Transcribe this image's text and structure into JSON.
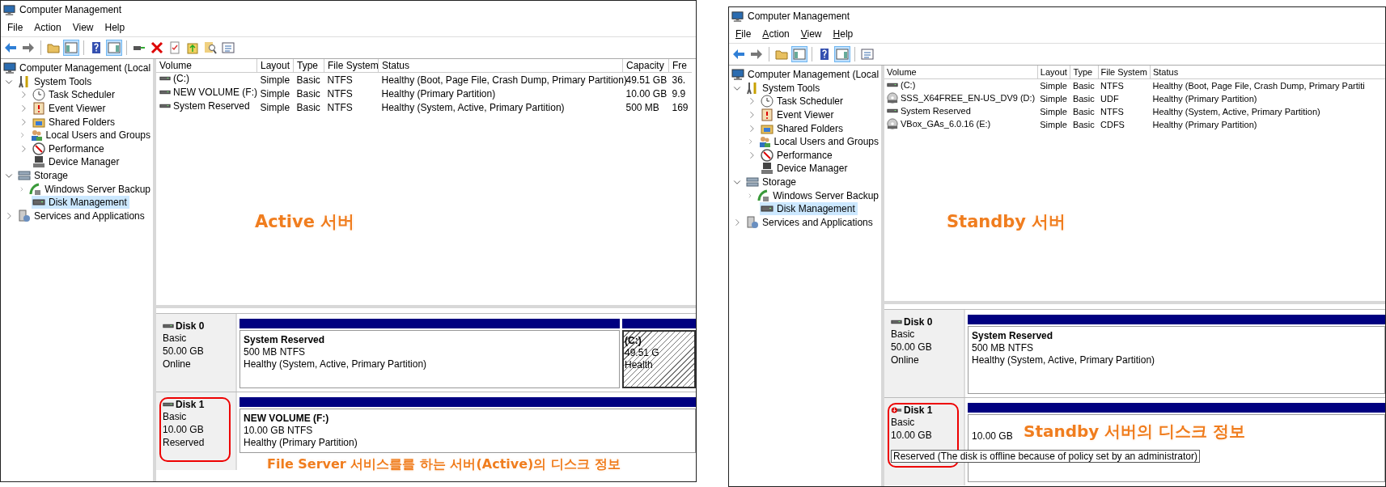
{
  "windows": [
    {
      "title": "Computer Management",
      "access_keys_underlined": false,
      "menu": [
        {
          "label": "File"
        },
        {
          "label": "Action"
        },
        {
          "label": "View"
        },
        {
          "label": "Help"
        }
      ],
      "toolbar": [
        {
          "kind": "back",
          "pressed": false
        },
        {
          "kind": "forward",
          "pressed": false
        },
        {
          "kind": "separator"
        },
        {
          "kind": "up",
          "pressed": false
        },
        {
          "kind": "tree",
          "pressed": true
        },
        {
          "kind": "separator"
        },
        {
          "kind": "help",
          "pressed": false
        },
        {
          "kind": "action",
          "pressed": true
        },
        {
          "kind": "separator"
        },
        {
          "kind": "connect",
          "pressed": false
        },
        {
          "kind": "delete",
          "pressed": false
        },
        {
          "kind": "check",
          "pressed": false
        },
        {
          "kind": "folderup",
          "pressed": false
        },
        {
          "kind": "search",
          "pressed": false
        },
        {
          "kind": "props",
          "pressed": false
        }
      ],
      "tree": [
        {
          "label": "Computer Management (Local",
          "kind": "computer",
          "expander": false,
          "selected": false,
          "children": [
            {
              "label": "System Tools",
              "kind": "tools",
              "expander": true,
              "expanded": true,
              "selected": false,
              "children": [
                {
                  "label": "Task Scheduler",
                  "kind": "clock",
                  "expander": true,
                  "expanded": false,
                  "selected": false
                },
                {
                  "label": "Event Viewer",
                  "kind": "event",
                  "expander": true,
                  "expanded": false,
                  "selected": false
                },
                {
                  "label": "Shared Folders",
                  "kind": "share",
                  "expander": true,
                  "expanded": false,
                  "selected": false
                },
                {
                  "label": "Local Users and Groups",
                  "kind": "users",
                  "expander": true,
                  "expanded": false,
                  "selected": false
                },
                {
                  "label": "Performance",
                  "kind": "perf",
                  "expander": true,
                  "expanded": false,
                  "selected": false
                },
                {
                  "label": "Device Manager",
                  "kind": "device",
                  "expander": false,
                  "expanded": false,
                  "selected": false
                }
              ]
            },
            {
              "label": "Storage",
              "kind": "storage",
              "expander": true,
              "expanded": true,
              "selected": false,
              "children": [
                {
                  "label": "Windows Server Backup",
                  "kind": "backup",
                  "expander": true,
                  "expanded": false,
                  "selected": false
                },
                {
                  "label": "Disk Management",
                  "kind": "diskmgmt",
                  "expander": false,
                  "expanded": false,
                  "selected": true
                }
              ]
            },
            {
              "label": "Services and Applications",
              "kind": "services",
              "expander": true,
              "expanded": false,
              "selected": false
            }
          ]
        }
      ],
      "volumes": {
        "columns": [
          "Volume",
          "Layout",
          "Type",
          "File System",
          "Status",
          "Capacity",
          "Fre"
        ],
        "rows": [
          {
            "kind": "drive",
            "cells": [
              "(C:)",
              "Simple",
              "Basic",
              "NTFS",
              "Healthy (Boot, Page File, Crash Dump, Primary Partition)",
              "49.51 GB",
              "36."
            ]
          },
          {
            "kind": "drive",
            "cells": [
              "NEW VOLUME (F:)",
              "Simple",
              "Basic",
              "NTFS",
              "Healthy (Primary Partition)",
              "10.00 GB",
              "9.9"
            ]
          },
          {
            "kind": "drive",
            "cells": [
              "System Reserved",
              "Simple",
              "Basic",
              "NTFS",
              "Healthy (System, Active, Primary Partition)",
              "500 MB",
              "169"
            ]
          }
        ]
      },
      "disks": [
        {
          "name": "Disk 0",
          "offline": false,
          "highlighted": false,
          "lines": [
            "Basic",
            "50.00 GB",
            "Online"
          ],
          "partitions": [
            {
              "title": "System Reserved",
              "lines": [
                "500 MB NTFS",
                "Healthy (System, Active, Primary Partition)"
              ],
              "selected": false
            },
            {
              "title": "(C:)",
              "lines": [
                "49.51 G",
                "Health"
              ],
              "selected": true
            }
          ]
        },
        {
          "name": "Disk 1",
          "offline": false,
          "highlighted": true,
          "lines": [
            "Basic",
            "10.00 GB",
            "Reserved"
          ],
          "partitions": [
            {
              "title": "NEW VOLUME  (F:)",
              "lines": [
                "10.00 GB NTFS",
                "Healthy (Primary Partition)"
              ],
              "selected": false
            }
          ]
        }
      ]
    },
    {
      "title": "Computer Management",
      "access_keys_underlined": true,
      "menu": [
        {
          "label": "File"
        },
        {
          "label": "Action"
        },
        {
          "label": "View"
        },
        {
          "label": "Help"
        }
      ],
      "toolbar": [
        {
          "kind": "back",
          "pressed": false
        },
        {
          "kind": "forward",
          "pressed": false
        },
        {
          "kind": "separator"
        },
        {
          "kind": "up",
          "pressed": false
        },
        {
          "kind": "tree",
          "pressed": true
        },
        {
          "kind": "separator"
        },
        {
          "kind": "help",
          "pressed": false
        },
        {
          "kind": "action",
          "pressed": true
        },
        {
          "kind": "separator"
        },
        {
          "kind": "props",
          "pressed": false
        }
      ],
      "tree": [
        {
          "label": "Computer Management (Local",
          "kind": "computer",
          "expander": false,
          "selected": false,
          "children": [
            {
              "label": "System Tools",
              "kind": "tools",
              "expander": true,
              "expanded": true,
              "selected": false,
              "children": [
                {
                  "label": "Task Scheduler",
                  "kind": "clock",
                  "expander": true,
                  "expanded": false,
                  "selected": false
                },
                {
                  "label": "Event Viewer",
                  "kind": "event",
                  "expander": true,
                  "expanded": false,
                  "selected": false
                },
                {
                  "label": "Shared Folders",
                  "kind": "share",
                  "expander": true,
                  "expanded": false,
                  "selected": false
                },
                {
                  "label": "Local Users and Groups",
                  "kind": "users",
                  "expander": true,
                  "expanded": false,
                  "selected": false
                },
                {
                  "label": "Performance",
                  "kind": "perf",
                  "expander": true,
                  "expanded": false,
                  "selected": false
                },
                {
                  "label": "Device Manager",
                  "kind": "device",
                  "expander": false,
                  "expanded": false,
                  "selected": false
                }
              ]
            },
            {
              "label": "Storage",
              "kind": "storage",
              "expander": true,
              "expanded": true,
              "selected": false,
              "children": [
                {
                  "label": "Windows Server Backup",
                  "kind": "backup",
                  "expander": true,
                  "expanded": false,
                  "selected": false
                },
                {
                  "label": "Disk Management",
                  "kind": "diskmgmt",
                  "expander": false,
                  "expanded": false,
                  "selected": true
                }
              ]
            },
            {
              "label": "Services and Applications",
              "kind": "services",
              "expander": true,
              "expanded": false,
              "selected": false
            }
          ]
        }
      ],
      "volumes": {
        "columns": [
          "Volume",
          "Layout",
          "Type",
          "File System",
          "Status"
        ],
        "rows": [
          {
            "kind": "drive",
            "cells": [
              "(C:)",
              "Simple",
              "Basic",
              "NTFS",
              "Healthy (Boot, Page File, Crash Dump, Primary Partiti"
            ]
          },
          {
            "kind": "disc",
            "cells": [
              "SSS_X64FREE_EN-US_DV9 (D:)",
              "Simple",
              "Basic",
              "UDF",
              "Healthy (Primary Partition)"
            ]
          },
          {
            "kind": "drive",
            "cells": [
              "System Reserved",
              "Simple",
              "Basic",
              "NTFS",
              "Healthy (System, Active, Primary Partition)"
            ]
          },
          {
            "kind": "disc",
            "cells": [
              "VBox_GAs_6.0.16 (E:)",
              "Simple",
              "Basic",
              "CDFS",
              "Healthy (Primary Partition)"
            ]
          }
        ]
      },
      "disks": [
        {
          "name": "Disk 0",
          "offline": false,
          "highlighted": false,
          "lines": [
            "Basic",
            "50.00 GB",
            "Online"
          ],
          "partitions": [
            {
              "title": "System Reserved",
              "lines": [
                "500 MB NTFS",
                "Healthy (System, Active, Primary Partition)"
              ],
              "selected": false
            }
          ]
        },
        {
          "name": "Disk 1",
          "offline": true,
          "highlighted": true,
          "lines": [
            "Basic",
            "10.00 GB"
          ],
          "tooltip": "Reserved (The disk is offline because of policy set by an administrator)",
          "partitions": [
            {
              "lines": [
                "10.00 GB"
              ],
              "selected": false
            }
          ]
        }
      ]
    }
  ],
  "annotations": [
    {
      "text": "Active 서버"
    },
    {
      "text": "File Server 서비스를를 하는 서버(Active)의 디스크 정보"
    },
    {
      "text": "Standby 서버"
    },
    {
      "text": "Standby 서버의 디스크 정보"
    }
  ]
}
